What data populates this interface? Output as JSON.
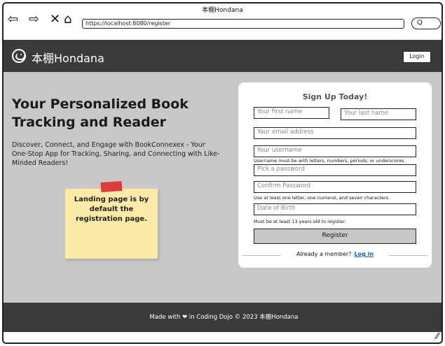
{
  "browser": {
    "window_title": "本棚Hondana",
    "url": "https://localhost:8080/register",
    "search_pill": "Q",
    "icons": [
      "back-arrow-icon",
      "forward-arrow-icon",
      "close-icon",
      "home-icon"
    ]
  },
  "header": {
    "brand": "本棚Hondana",
    "login_label": "Login"
  },
  "hero": {
    "title": "Your Personalized Book Tracking and Reader",
    "description": "Discover, Connect, and Engage with BookConnexex - Your One-Stop App for Tracking, Sharing, and Connecting with Like-Minded Readers!",
    "sticky_note": "Landing page is by default the registration page."
  },
  "signup": {
    "title": "Sign Up Today!",
    "first_name_placeholder": "Your first name",
    "last_name_placeholder": "Your last name",
    "email_placeholder": "Your email address",
    "username_placeholder": "Your username",
    "username_hint": "Username must be with letters, numbers, periods, or underscores.",
    "password_placeholder": "Pick a password",
    "confirm_placeholder": "Confirm Password",
    "password_hint": "Use at least one letter, one numeral, and seven characters.",
    "dob_placeholder": "Date of Birth",
    "dob_hint": "Must be at least 13 years old to register.",
    "register_label": "Register",
    "member_text": "Already a member?",
    "login_link": "Log in"
  },
  "footer": {
    "text": "Made with ❤ in Coding Dojo © 2023 本棚Hondana"
  },
  "colors": {
    "header_bg": "#3b3b3b",
    "main_bg": "#c8c8c8",
    "sticky_note": "#fde9a8",
    "tape": "#e03a3a",
    "link": "#1a5fb4"
  }
}
